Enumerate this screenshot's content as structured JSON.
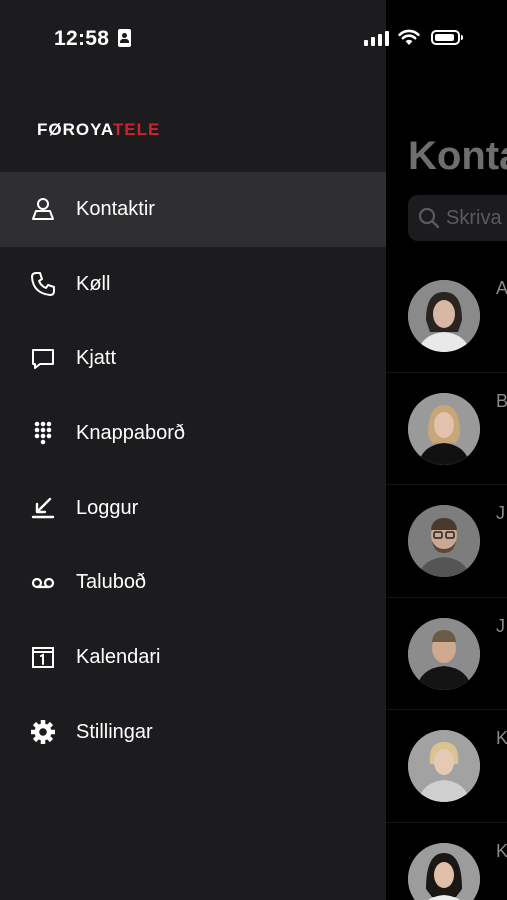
{
  "status": {
    "time": "12:58"
  },
  "logo": {
    "part1": "FØROYA",
    "part2": "TELE"
  },
  "menu": {
    "items": [
      {
        "label": "Kontaktir",
        "icon": "contacts-icon",
        "active": true
      },
      {
        "label": "Køll",
        "icon": "phone-icon"
      },
      {
        "label": "Kjatt",
        "icon": "chat-icon"
      },
      {
        "label": "Knappaborð",
        "icon": "keypad-icon"
      },
      {
        "label": "Loggur",
        "icon": "log-icon"
      },
      {
        "label": "Taluboð",
        "icon": "voicemail-icon"
      },
      {
        "label": "Kalendari",
        "icon": "calendar-icon"
      },
      {
        "label": "Stillingar",
        "icon": "gear-icon"
      }
    ]
  },
  "content": {
    "title": "Konta",
    "search_placeholder": "Skriva",
    "contacts": [
      {
        "initial": "A"
      },
      {
        "initial": "B"
      },
      {
        "initial": "J"
      },
      {
        "initial": "J"
      },
      {
        "initial": "K"
      },
      {
        "initial": "K"
      }
    ]
  },
  "colors": {
    "drawer_bg": "#1c1c1e",
    "active_bg": "#2f2f31",
    "brand_red": "#d2202f"
  }
}
